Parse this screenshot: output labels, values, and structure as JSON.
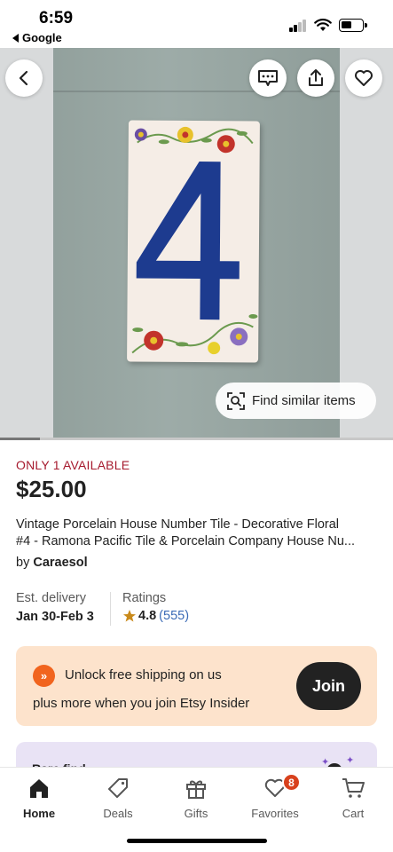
{
  "status_bar": {
    "time": "6:59",
    "back_app": "Google"
  },
  "hero": {
    "find_similar_label": "Find similar items",
    "icons": {
      "back": "back-arrow-icon",
      "message": "message-icon",
      "share": "share-icon",
      "favorite": "heart-icon"
    },
    "tile_number": "4"
  },
  "product": {
    "stock": "ONLY 1 AVAILABLE",
    "price": "$25.00",
    "title_line1": "Vintage Porcelain House Number Tile - Decorative Floral",
    "title_line2": "#4 - Ramona Pacific Tile & Porcelain Company House Nu...",
    "seller_prefix": "by",
    "seller_name": "Caraesol"
  },
  "details": {
    "delivery_label": "Est. delivery",
    "delivery_value": "Jan 30-Feb 3",
    "ratings_label": "Ratings",
    "rating_value": "4.8",
    "rating_count": "(555)"
  },
  "insider_banner": {
    "icon": "double-chevron-icon",
    "line1": "Unlock free shipping on us",
    "line2": "plus more when you join Etsy Insider",
    "join_label": "Join"
  },
  "rare_find": {
    "text": "Rare find"
  },
  "tabbar": {
    "items": [
      {
        "label": "Home",
        "icon": "home-icon",
        "active": true
      },
      {
        "label": "Deals",
        "icon": "tag-icon"
      },
      {
        "label": "Gifts",
        "icon": "gift-icon"
      },
      {
        "label": "Favorites",
        "icon": "heart-icon",
        "badge": "8"
      },
      {
        "label": "Cart",
        "icon": "cart-icon"
      }
    ]
  },
  "colors": {
    "stock_red": "#a61a2e",
    "etsy_orange": "#f1641e",
    "insider_bg": "#fde3cc",
    "link_blue": "#3b6bb6",
    "badge_red": "#d8411d"
  }
}
